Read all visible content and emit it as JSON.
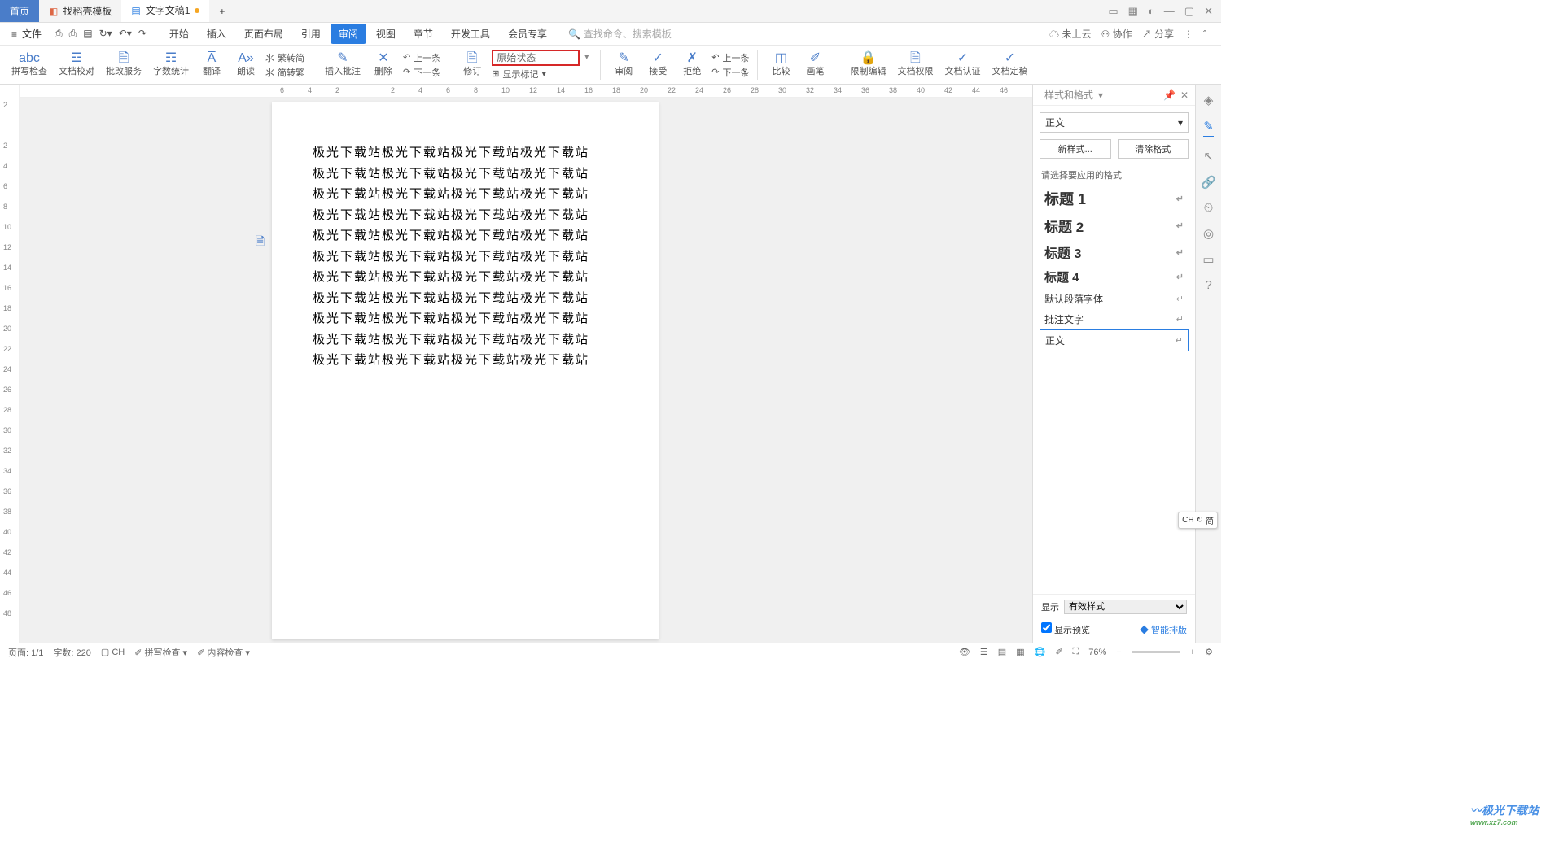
{
  "tabs": {
    "home": "首页",
    "t1": "找稻壳模板",
    "t2": "文字文稿1",
    "new": "+"
  },
  "file_menu": "文件",
  "menu": [
    "开始",
    "插入",
    "页面布局",
    "引用",
    "审阅",
    "视图",
    "章节",
    "开发工具",
    "会员专享"
  ],
  "menu_active_index": 4,
  "search_placeholder": "查找命令、搜索模板",
  "top_right": {
    "cloud": "未上云",
    "collab": "协作",
    "share": "分享"
  },
  "ribbon": {
    "spellcheck": "拼写检查",
    "proofread": "文档校对",
    "review_service": "批改服务",
    "wordcount": "字数统计",
    "translate": "翻译",
    "read": "朗读",
    "trad2simp": "繁转简",
    "simp2trad": "简转繁",
    "insert_comment": "插入批注",
    "delete": "删除",
    "prev": "上一条",
    "next": "下一条",
    "revise": "修订",
    "state_value": "原始状态",
    "show_mark": "显示标记",
    "review": "审阅",
    "accept": "接受",
    "reject": "拒绝",
    "compare": "比较",
    "brush": "画笔",
    "restrict": "限制编辑",
    "permission": "文档权限",
    "authenticate": "文档认证",
    "finalize": "文档定稿"
  },
  "doc_lines": [
    "极光下载站极光下载站极光下载站极光下载站",
    "极光下载站极光下载站极光下载站极光下载站",
    "极光下载站极光下载站极光下载站极光下载站",
    "极光下载站极光下载站极光下载站极光下载站",
    "极光下载站极光下载站极光下载站极光下载站",
    "极光下载站极光下载站极光下载站极光下载站",
    "极光下载站极光下载站极光下载站极光下载站",
    "极光下载站极光下载站极光下载站极光下载站",
    "极光下载站极光下载站极光下载站极光下载站",
    "极光下载站极光下载站极光下载站极光下载站",
    "极光下载站极光下载站极光下载站极光下载站"
  ],
  "hruler_ticks": [
    "6",
    "4",
    "2",
    "",
    "2",
    "4",
    "6",
    "8",
    "10",
    "12",
    "14",
    "16",
    "18",
    "20",
    "22",
    "24",
    "26",
    "28",
    "30",
    "32",
    "34",
    "36",
    "38",
    "40",
    "42",
    "44",
    "46"
  ],
  "vruler_ticks": [
    "2",
    "",
    "2",
    "4",
    "6",
    "8",
    "10",
    "12",
    "14",
    "16",
    "18",
    "20",
    "22",
    "24",
    "26",
    "28",
    "30",
    "32",
    "34",
    "36",
    "38",
    "40",
    "42",
    "44",
    "46",
    "48"
  ],
  "panel": {
    "title": "样式和格式",
    "current": "正文",
    "new_style": "新样式...",
    "clear": "清除格式",
    "prompt": "请选择要应用的格式",
    "styles": [
      {
        "name": "标题 1",
        "cls": "h h1"
      },
      {
        "name": "标题 2",
        "cls": "h h2"
      },
      {
        "name": "标题 3",
        "cls": "h h3"
      },
      {
        "name": "标题 4",
        "cls": "h h4"
      },
      {
        "name": "默认段落字体",
        "cls": ""
      },
      {
        "name": "批注文字",
        "cls": ""
      },
      {
        "name": "正文",
        "cls": "selected"
      }
    ],
    "show": "显示",
    "show_value": "有效样式",
    "preview_chk": "显示预览",
    "smart_layout": "智能排版"
  },
  "ime": {
    "lang": "CH",
    "mode": "简"
  },
  "status": {
    "page": "页面: 1/1",
    "words": "字数: 220",
    "lang": "CH",
    "spell": "拼写检查",
    "content": "内容检查",
    "zoom": "76%"
  },
  "watermark": {
    "brand": "极光下载站",
    "url": "www.xz7.com"
  }
}
